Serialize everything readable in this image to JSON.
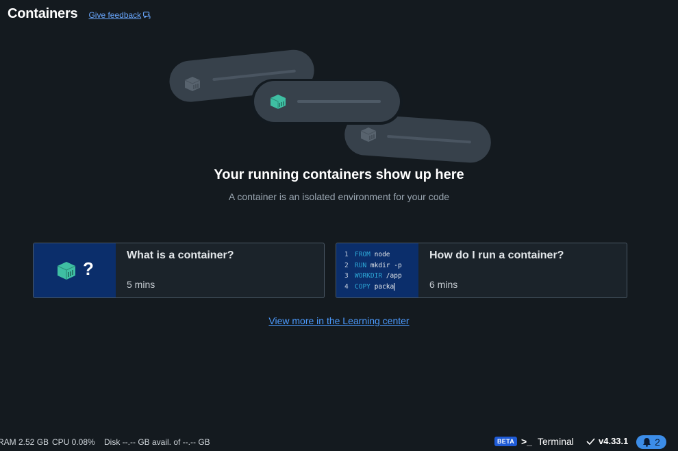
{
  "header": {
    "title": "Containers",
    "feedback_label": "Give feedback"
  },
  "hero": {
    "title": "Your running containers show up here",
    "subtitle": "A container is an isolated environment for your code"
  },
  "cards": [
    {
      "title": "What is a container?",
      "time": "5 mins",
      "thumb_icon": "container-question-icon"
    },
    {
      "title": "How do I run a container?",
      "time": "6 mins",
      "code_lines": [
        {
          "num": "1",
          "keyword": "FROM",
          "text": "node"
        },
        {
          "num": "2",
          "keyword": "RUN",
          "text": "mkdir -p"
        },
        {
          "num": "3",
          "keyword": "WORKDIR",
          "text": "/app"
        },
        {
          "num": "4",
          "keyword": "COPY",
          "text": "packa"
        }
      ]
    }
  ],
  "learn_link": "View more in the Learning center",
  "status_bar": {
    "ram": "RAM 2.52 GB",
    "cpu": "CPU 0.08%",
    "disk": "Disk --.-- GB avail. of --.-- GB",
    "beta_badge": "BETA",
    "terminal_icon": ">_",
    "terminal_label": "Terminal",
    "version": "v4.33.1",
    "notification_count": "2"
  },
  "colors": {
    "background": "#141a1f",
    "link": "#4c9bff",
    "card_thumb": "#0b2e6b",
    "container_teal": "#3fbfa3",
    "container_grey": "#5a6570",
    "notification": "#3c8de8"
  }
}
